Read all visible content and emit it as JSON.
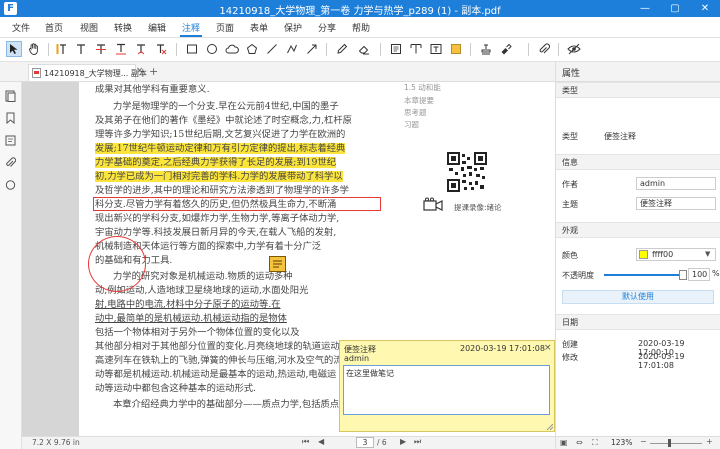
{
  "window": {
    "title": "14210918_大学物理_第一卷 力学与热学_p289 (1) - 副本.pdf",
    "logo": "F",
    "minimize": "—",
    "maximize": "▢",
    "close": "✕"
  },
  "menu": [
    "文件",
    "首页",
    "视图",
    "转换",
    "编辑",
    "注释",
    "页面",
    "表单",
    "保护",
    "分享",
    "帮助"
  ],
  "menu_active": "注释",
  "tab": {
    "label": "14210918_大学物理... 副本",
    "close": "×",
    "add": "+"
  },
  "colors": {
    "brand": "#1d7fd9",
    "highlight": "#fbe53d",
    "markup": "#e53935",
    "note_bg": "#fff8b0"
  },
  "toolbar_icons": [
    "select-icon",
    "hand-icon",
    "highlight-icon",
    "text-icon",
    "strikethrough-icon",
    "underline-icon",
    "insert-text-icon",
    "replace-text-icon",
    "rectangle-icon",
    "ellipse-icon",
    "cloud-icon",
    "polygon-icon",
    "line-icon",
    "polyline-icon",
    "arrow-icon",
    "pencil-icon",
    "eraser-icon",
    "text-box-icon",
    "callout-icon",
    "text-field-icon",
    "note-icon",
    "stamp-icon",
    "area-highlight-icon",
    "attachment-icon",
    "hide-annotations-icon"
  ],
  "page_lines": [
    "成果对其他学科有重要意义.",
    "力学是物理学的一个分支.早在公元前4世纪,中国的墨子",
    "及其弟子在他们的著作《墨经》中就论述了时空概念,力,杠杆原",
    "理等许多力学知识;15世纪后期,文艺复兴促进了力学在欧洲的",
    "发展;17世纪牛顿运动定律和万有引力定律的提出,标志着经典",
    "力学基础的奠定,之后经典力学获得了长足的发展;到19世纪",
    "初,力学已成为一门相对完善的学科.力学的发展带动了科学以",
    "及哲学的进步,其中的理论和研究方法渗透到了物理学的许多学",
    "科分支.尽管力学有着悠久的历史,但仍然极具生命力,不断涌",
    "现出新兴的学科分支,如爆炸力学,生物力学,等离子体动力学,",
    "宇宙动力学等.科技发展日新月异的今天,在载人飞船的发射,",
    "机械制造和天体运行等方面的探索中,力学有着十分广泛",
    "的基础和有力工具.",
    "力学的研究对象是机械运动.物质的运动多种",
    "动,例如运动,人造地球卫星绕地球的运动,水面处阳光",
    "射,电路中的电流,材料中分子原子的运动等.在",
    "动中,最简单的是机械运动.机械运动指的是物体",
    "包括一个物体相对于另外一个物体位置的变化以及",
    "其他部分相对于其他部分位置的变化.月亮绕地球的轨道运动,",
    "高速列车在铁轨上的飞驰,弹簧的伸长与压缩,河水及空气的流",
    "动等都是机械运动.机械运动是最基本的运动,热运动,电磁运",
    "动等运动中都包含这种基本的运动形式.",
    "本章介绍经典力学中的基础部分——质点力学,包括质点运"
  ],
  "gutter": {
    "items": [
      "1.5 动和能",
      "本章提要",
      "思考题",
      "习题"
    ],
    "qr_caption": "提课录像:绪论"
  },
  "note": {
    "title": "便签注释",
    "timestamp": "2020-03-19 17:01:08",
    "close": "×",
    "author": "admin",
    "content": "在这里做笔记"
  },
  "status": {
    "dimensions": "7.2 X 9.76 in",
    "page_current": "3",
    "page_total": "/ 6",
    "zoom": "123%"
  },
  "properties": {
    "header": "属性",
    "section_type": "类型",
    "type_label": "类型",
    "type_value": "便签注释",
    "section_info": "信息",
    "author_label": "作者",
    "author_value": "admin",
    "subject_label": "主题",
    "subject_value": "便签注释",
    "section_appearance": "外观",
    "color_label": "颜色",
    "color_value": "ffff00",
    "color_swatch": "#ffff00",
    "opacity_label": "不透明度",
    "opacity_value": "100",
    "opacity_unit": "%",
    "opacity_fraction": 1.0,
    "default_button": "默认使用",
    "section_date": "日期",
    "created_label": "创建",
    "created_value": "2020-03-19 17:00:10",
    "modified_label": "修改",
    "modified_value": "2020-03-19 17:01:08"
  }
}
